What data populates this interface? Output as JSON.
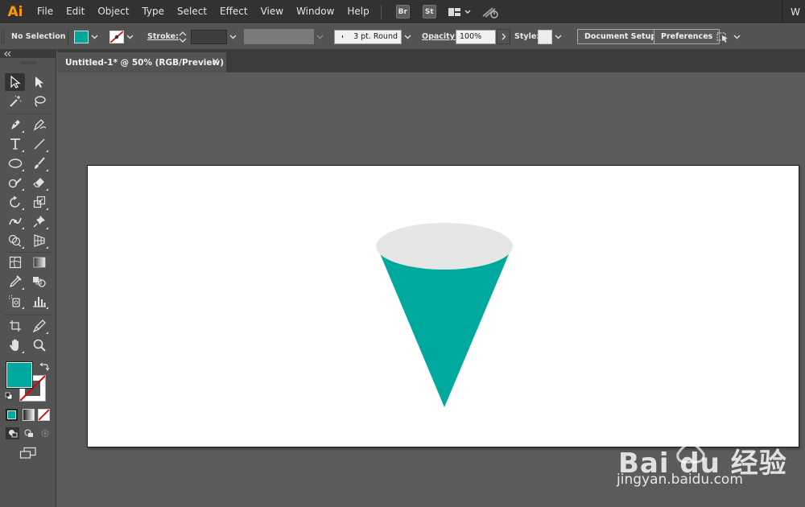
{
  "app": {
    "logo": "Ai"
  },
  "menu": {
    "items": [
      "File",
      "Edit",
      "Object",
      "Type",
      "Select",
      "Effect",
      "View",
      "Window",
      "Help"
    ],
    "badges": [
      "Br",
      "St"
    ],
    "right_text": "W"
  },
  "control": {
    "selection": "No Selection",
    "stroke_label": "Stroke:",
    "profile": "3 pt. Round",
    "opacity_label": "Opacity:",
    "opacity_value": "100%",
    "style_label": "Style:",
    "document_setup": "Document Setup",
    "preferences": "Preferences"
  },
  "document": {
    "tab_title": "Untitled-1* @ 50% (RGB/Preview)",
    "close": "✕"
  },
  "colors": {
    "fill": "#00a99d",
    "cone_top": "#e6e6e6",
    "app_logo": "#ff9a00",
    "stroke_none": "#e00000"
  },
  "artwork": {
    "shapes": [
      {
        "name": "cone-body",
        "kind": "triangle",
        "color": "#00a99d"
      },
      {
        "name": "cone-top-ellipse",
        "kind": "ellipse",
        "color": "#e6e6e6"
      }
    ]
  },
  "tools": [
    "selection-tool",
    "direct-selection-tool",
    "magic-wand-tool",
    "lasso-tool",
    "pen-tool",
    "curvature-tool",
    "type-tool",
    "line-segment-tool",
    "ellipse-tool",
    "paintbrush-tool",
    "shaper-tool",
    "eraser-tool",
    "rotate-tool",
    "scale-tool",
    "width-tool",
    "puppet-warp-tool",
    "shape-builder-tool",
    "perspective-grid-tool",
    "mesh-tool",
    "gradient-tool",
    "eyedropper-tool",
    "blend-tool",
    "symbol-sprayer-tool",
    "column-graph-tool",
    "artboard-tool",
    "slice-tool",
    "hand-tool",
    "zoom-tool"
  ],
  "watermark": {
    "logo": "Bai du 经验",
    "url": "jingyan.baidu.com"
  }
}
